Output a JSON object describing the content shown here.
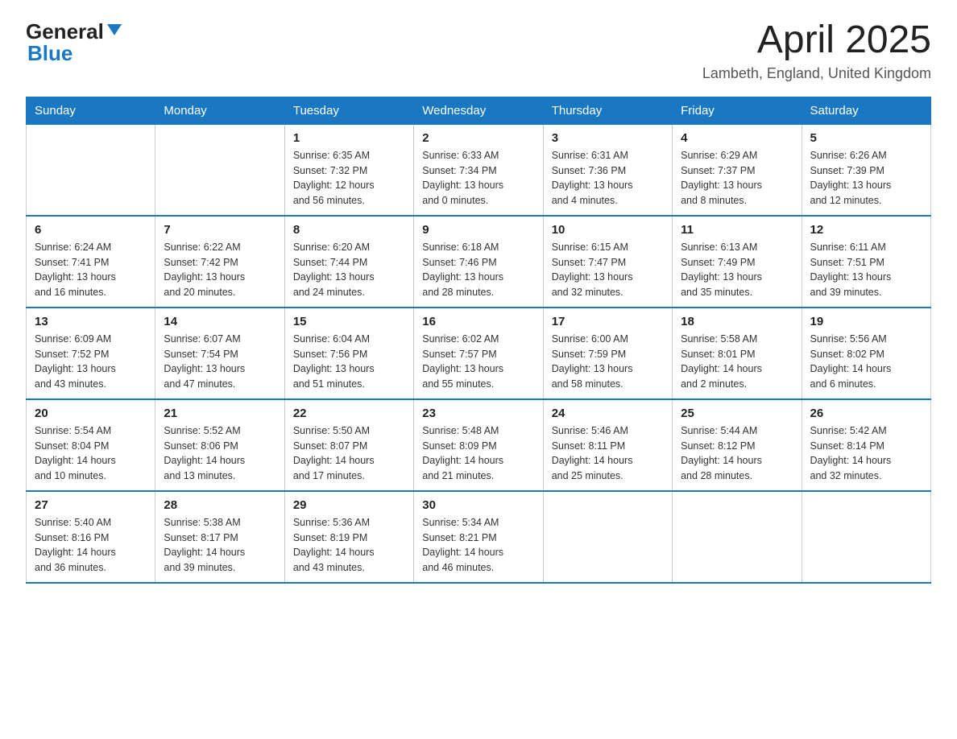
{
  "header": {
    "logo_general": "General",
    "logo_blue": "Blue",
    "month_title": "April 2025",
    "location": "Lambeth, England, United Kingdom"
  },
  "days_of_week": [
    "Sunday",
    "Monday",
    "Tuesday",
    "Wednesday",
    "Thursday",
    "Friday",
    "Saturday"
  ],
  "weeks": [
    [
      {
        "day": "",
        "info": ""
      },
      {
        "day": "",
        "info": ""
      },
      {
        "day": "1",
        "info": "Sunrise: 6:35 AM\nSunset: 7:32 PM\nDaylight: 12 hours\nand 56 minutes."
      },
      {
        "day": "2",
        "info": "Sunrise: 6:33 AM\nSunset: 7:34 PM\nDaylight: 13 hours\nand 0 minutes."
      },
      {
        "day": "3",
        "info": "Sunrise: 6:31 AM\nSunset: 7:36 PM\nDaylight: 13 hours\nand 4 minutes."
      },
      {
        "day": "4",
        "info": "Sunrise: 6:29 AM\nSunset: 7:37 PM\nDaylight: 13 hours\nand 8 minutes."
      },
      {
        "day": "5",
        "info": "Sunrise: 6:26 AM\nSunset: 7:39 PM\nDaylight: 13 hours\nand 12 minutes."
      }
    ],
    [
      {
        "day": "6",
        "info": "Sunrise: 6:24 AM\nSunset: 7:41 PM\nDaylight: 13 hours\nand 16 minutes."
      },
      {
        "day": "7",
        "info": "Sunrise: 6:22 AM\nSunset: 7:42 PM\nDaylight: 13 hours\nand 20 minutes."
      },
      {
        "day": "8",
        "info": "Sunrise: 6:20 AM\nSunset: 7:44 PM\nDaylight: 13 hours\nand 24 minutes."
      },
      {
        "day": "9",
        "info": "Sunrise: 6:18 AM\nSunset: 7:46 PM\nDaylight: 13 hours\nand 28 minutes."
      },
      {
        "day": "10",
        "info": "Sunrise: 6:15 AM\nSunset: 7:47 PM\nDaylight: 13 hours\nand 32 minutes."
      },
      {
        "day": "11",
        "info": "Sunrise: 6:13 AM\nSunset: 7:49 PM\nDaylight: 13 hours\nand 35 minutes."
      },
      {
        "day": "12",
        "info": "Sunrise: 6:11 AM\nSunset: 7:51 PM\nDaylight: 13 hours\nand 39 minutes."
      }
    ],
    [
      {
        "day": "13",
        "info": "Sunrise: 6:09 AM\nSunset: 7:52 PM\nDaylight: 13 hours\nand 43 minutes."
      },
      {
        "day": "14",
        "info": "Sunrise: 6:07 AM\nSunset: 7:54 PM\nDaylight: 13 hours\nand 47 minutes."
      },
      {
        "day": "15",
        "info": "Sunrise: 6:04 AM\nSunset: 7:56 PM\nDaylight: 13 hours\nand 51 minutes."
      },
      {
        "day": "16",
        "info": "Sunrise: 6:02 AM\nSunset: 7:57 PM\nDaylight: 13 hours\nand 55 minutes."
      },
      {
        "day": "17",
        "info": "Sunrise: 6:00 AM\nSunset: 7:59 PM\nDaylight: 13 hours\nand 58 minutes."
      },
      {
        "day": "18",
        "info": "Sunrise: 5:58 AM\nSunset: 8:01 PM\nDaylight: 14 hours\nand 2 minutes."
      },
      {
        "day": "19",
        "info": "Sunrise: 5:56 AM\nSunset: 8:02 PM\nDaylight: 14 hours\nand 6 minutes."
      }
    ],
    [
      {
        "day": "20",
        "info": "Sunrise: 5:54 AM\nSunset: 8:04 PM\nDaylight: 14 hours\nand 10 minutes."
      },
      {
        "day": "21",
        "info": "Sunrise: 5:52 AM\nSunset: 8:06 PM\nDaylight: 14 hours\nand 13 minutes."
      },
      {
        "day": "22",
        "info": "Sunrise: 5:50 AM\nSunset: 8:07 PM\nDaylight: 14 hours\nand 17 minutes."
      },
      {
        "day": "23",
        "info": "Sunrise: 5:48 AM\nSunset: 8:09 PM\nDaylight: 14 hours\nand 21 minutes."
      },
      {
        "day": "24",
        "info": "Sunrise: 5:46 AM\nSunset: 8:11 PM\nDaylight: 14 hours\nand 25 minutes."
      },
      {
        "day": "25",
        "info": "Sunrise: 5:44 AM\nSunset: 8:12 PM\nDaylight: 14 hours\nand 28 minutes."
      },
      {
        "day": "26",
        "info": "Sunrise: 5:42 AM\nSunset: 8:14 PM\nDaylight: 14 hours\nand 32 minutes."
      }
    ],
    [
      {
        "day": "27",
        "info": "Sunrise: 5:40 AM\nSunset: 8:16 PM\nDaylight: 14 hours\nand 36 minutes."
      },
      {
        "day": "28",
        "info": "Sunrise: 5:38 AM\nSunset: 8:17 PM\nDaylight: 14 hours\nand 39 minutes."
      },
      {
        "day": "29",
        "info": "Sunrise: 5:36 AM\nSunset: 8:19 PM\nDaylight: 14 hours\nand 43 minutes."
      },
      {
        "day": "30",
        "info": "Sunrise: 5:34 AM\nSunset: 8:21 PM\nDaylight: 14 hours\nand 46 minutes."
      },
      {
        "day": "",
        "info": ""
      },
      {
        "day": "",
        "info": ""
      },
      {
        "day": "",
        "info": ""
      }
    ]
  ]
}
